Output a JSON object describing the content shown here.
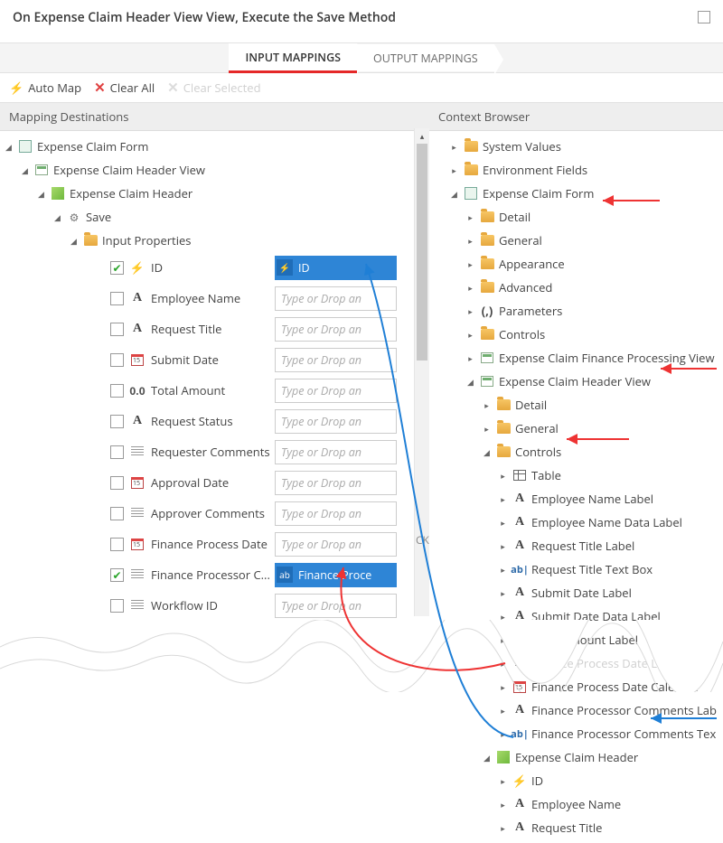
{
  "header": {
    "title": "On Expense Claim Header View View, Execute the Save Method"
  },
  "tabs": {
    "input": "INPUT MAPPINGS",
    "output": "OUTPUT MAPPINGS"
  },
  "toolbar": {
    "automap": "Auto Map",
    "clearall": "Clear All",
    "clearsel": "Clear Selected"
  },
  "leftTitle": "Mapping Destinations",
  "rightTitle": "Context Browser",
  "placeholder": "Type or Drop an",
  "ckLabel": "CK",
  "destTree": {
    "root": "Expense Claim Form",
    "view": "Expense Claim Header View",
    "so": "Expense Claim Header",
    "method": "Save",
    "folder": "Input Properties"
  },
  "props": [
    {
      "label": "ID",
      "checked": true,
      "icon": "bolt",
      "valueIcon": "bolt",
      "value": "ID"
    },
    {
      "label": "Employee Name",
      "checked": false,
      "icon": "A"
    },
    {
      "label": "Request Title",
      "checked": false,
      "icon": "A"
    },
    {
      "label": "Submit Date",
      "checked": false,
      "icon": "cal"
    },
    {
      "label": "Total Amount",
      "checked": false,
      "icon": "num"
    },
    {
      "label": "Request Status",
      "checked": false,
      "icon": "A"
    },
    {
      "label": "Requester Comments",
      "checked": false,
      "icon": "lines"
    },
    {
      "label": "Approval Date",
      "checked": false,
      "icon": "cal"
    },
    {
      "label": "Approver Comments",
      "checked": false,
      "icon": "lines"
    },
    {
      "label": "Finance Process Date",
      "checked": false,
      "icon": "cal"
    },
    {
      "label": "Finance Processor C...",
      "checked": true,
      "icon": "lines",
      "valueIcon": "abl",
      "value": "Finance Proce"
    },
    {
      "label": "Workflow ID",
      "checked": false,
      "icon": "lines"
    }
  ],
  "ctx": {
    "sysValues": "System Values",
    "envFields": "Environment Fields",
    "form": "Expense Claim Form",
    "formChildren": [
      "Detail",
      "General",
      "Appearance",
      "Advanced"
    ],
    "parameters": "Parameters",
    "controlsTop": "Controls",
    "financeView": "Expense Claim Finance Processing View",
    "headerView": "Expense Claim Header View",
    "headerViewChildren": [
      "Detail",
      "General"
    ],
    "controls": "Controls",
    "controlItems": [
      {
        "icon": "table",
        "label": "Table"
      },
      {
        "icon": "A",
        "label": "Employee Name Label"
      },
      {
        "icon": "A2",
        "label": "Employee Name Data Label"
      },
      {
        "icon": "A",
        "label": "Request Title Label"
      },
      {
        "icon": "abl",
        "label": "Request Title Text Box"
      },
      {
        "icon": "A",
        "label": "Submit Date Label"
      },
      {
        "icon": "A2",
        "label": "Submit Date Data Label"
      },
      {
        "icon": "A",
        "label": "Total Amount Label"
      },
      {
        "icon": "A",
        "label": "Finance Process Date Label",
        "cut": true
      },
      {
        "icon": "cal",
        "label": "Finance Process Date Calendar"
      },
      {
        "icon": "A",
        "label": "Finance Processor Comments Lab"
      },
      {
        "icon": "abl",
        "label": "Finance Processor Comments Tex"
      }
    ],
    "so": "Expense Claim Header",
    "soFields": [
      {
        "icon": "bolt",
        "label": "ID"
      },
      {
        "icon": "A",
        "label": "Employee Name"
      },
      {
        "icon": "A",
        "label": "Request Title"
      }
    ]
  }
}
